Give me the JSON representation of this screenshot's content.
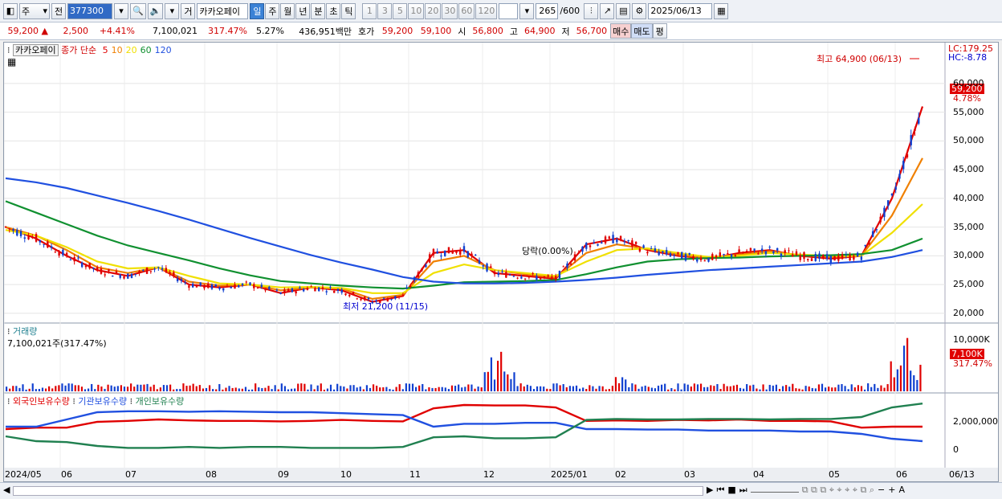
{
  "toolbar": {
    "market": "주",
    "prev": "전",
    "code": "377300",
    "trade_btn": "거",
    "stock_name": "카카오페이",
    "periods": [
      "일",
      "주",
      "월",
      "년",
      "분",
      "초",
      "틱"
    ],
    "active_period": "일",
    "nums": [
      "1",
      "3",
      "5",
      "10",
      "20",
      "30",
      "60",
      "120"
    ],
    "count": "265",
    "count_max": "/600",
    "date": "2025/06/13"
  },
  "quote": {
    "price": "59,200",
    "change": "2,500",
    "change_pct": "+4.41%",
    "volume": "7,100,021",
    "vol_ratio": "317.47%",
    "turnover": "5.27%",
    "amount": "436,951백만",
    "bid_label": "호가",
    "ask": "59,200",
    "bid": "59,100",
    "open_label": "시",
    "open": "56,800",
    "high_label": "고",
    "high": "64,900",
    "low_label": "저",
    "low": "56,700",
    "buy_btn": "매수",
    "sell_btn": "매도",
    "eval_btn": "평"
  },
  "price_pane": {
    "name_tag": "카카오페이",
    "ma_title": "종가 단순",
    "ma_periods": [
      "5",
      "10",
      "20",
      "60",
      "120"
    ],
    "ma_colors": [
      "#e00000",
      "#f08000",
      "#f0e000",
      "#109030",
      "#2050e0"
    ],
    "lc": "LC:179.25",
    "hc": "HC:-8.78",
    "current_tag": "59,200",
    "current_pct": "4.78%",
    "high_note": "최고 64,900 (06/13)",
    "low_note": "최저 21,200 (11/15)",
    "drop_note": "당락(0.00%)"
  },
  "volume_pane": {
    "title": "거래량",
    "value": "7,100,021주(317.47%)",
    "axis_label": "10,000K",
    "tag": "7,100K",
    "tag_pct": "317.47%"
  },
  "holding_pane": {
    "legend": [
      "외국인보유수량",
      "기관보유수량",
      "개인보유수량"
    ],
    "colors": [
      "#e00000",
      "#2050e0",
      "#208050"
    ],
    "axis": [
      "2,000,000",
      "0"
    ]
  },
  "chart_data": {
    "type": "line",
    "price_axis": [
      "60,000",
      "55,000",
      "50,000",
      "45,000",
      "40,000",
      "35,000",
      "30,000",
      "25,000",
      "20,000"
    ],
    "x_labels": [
      "2024/05",
      "06",
      "07",
      "08",
      "09",
      "10",
      "11",
      "12",
      "2025/01",
      "02",
      "03",
      "04",
      "05",
      "06",
      "06/13"
    ],
    "ylim": [
      19000,
      66000
    ],
    "series": [
      {
        "name": "5",
        "values": [
          35000,
          33000,
          30000,
          27500,
          26500,
          28000,
          25000,
          24500,
          25000,
          23500,
          24500,
          24000,
          22000,
          23000,
          30500,
          31000,
          27000,
          26500,
          26000,
          32000,
          33000,
          31000,
          30000,
          29500,
          30500,
          31000,
          30000,
          29500,
          30000,
          40000,
          56000
        ]
      },
      {
        "name": "10",
        "values": [
          35000,
          33500,
          31000,
          28000,
          27000,
          28000,
          25500,
          24800,
          25000,
          24000,
          24500,
          24300,
          22500,
          23200,
          29000,
          30000,
          27500,
          26800,
          26200,
          30500,
          32000,
          31200,
          30200,
          29600,
          30200,
          30800,
          30100,
          29800,
          30000,
          37000,
          47000
        ]
      },
      {
        "name": "20",
        "values": [
          34500,
          33500,
          31500,
          29000,
          27800,
          28000,
          26500,
          25200,
          25000,
          24500,
          24600,
          24400,
          23500,
          23500,
          27000,
          28500,
          27500,
          27000,
          26500,
          29000,
          31000,
          31300,
          30500,
          29800,
          30000,
          30500,
          30200,
          30000,
          30000,
          34000,
          39000
        ]
      },
      {
        "name": "60",
        "values": [
          39500,
          37500,
          35500,
          33500,
          31800,
          30500,
          29200,
          27800,
          26600,
          25600,
          25200,
          24800,
          24500,
          24300,
          24800,
          25400,
          25500,
          25600,
          25800,
          26800,
          28000,
          29000,
          29400,
          29600,
          29700,
          29900,
          30000,
          30100,
          30300,
          31000,
          33000
        ]
      },
      {
        "name": "120",
        "values": [
          43500,
          42800,
          41800,
          40500,
          39200,
          37800,
          36300,
          34700,
          33100,
          31600,
          30100,
          28800,
          27600,
          26300,
          25500,
          25200,
          25200,
          25300,
          25500,
          25800,
          26200,
          26700,
          27100,
          27500,
          27800,
          28100,
          28400,
          28700,
          29000,
          29800,
          31000
        ]
      }
    ]
  }
}
